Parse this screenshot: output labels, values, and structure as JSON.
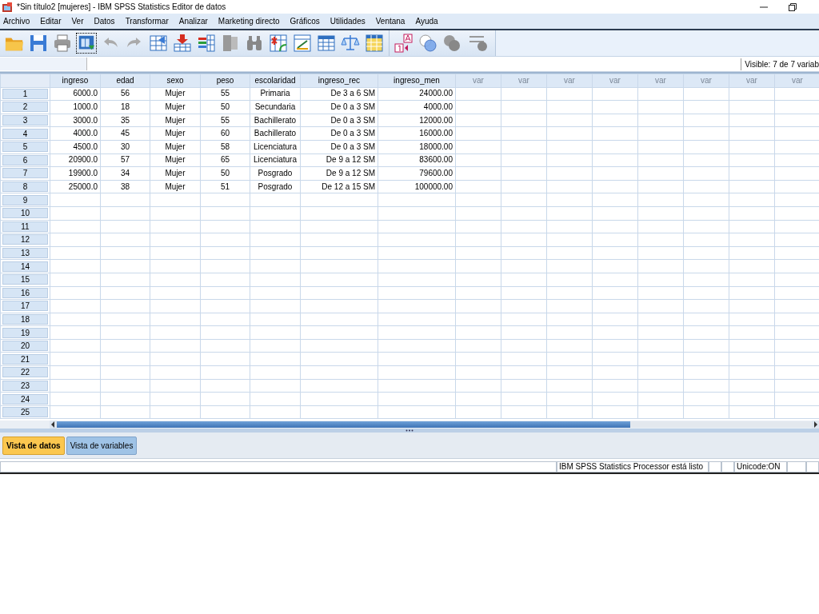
{
  "window": {
    "title": "*Sin título2 [mujeres] - IBM SPSS Statistics Editor de datos"
  },
  "menu": [
    "Archivo",
    "Editar",
    "Ver",
    "Datos",
    "Transformar",
    "Analizar",
    "Marketing directo",
    "Gráficos",
    "Utilidades",
    "Ventana",
    "Ayuda"
  ],
  "visible_info": "Visible: 7 de 7 variab",
  "table": {
    "columns": [
      {
        "label": "ingreso",
        "kind": "variable"
      },
      {
        "label": "edad",
        "kind": "variable"
      },
      {
        "label": "sexo",
        "kind": "variable"
      },
      {
        "label": "peso",
        "kind": "variable"
      },
      {
        "label": "escolaridad",
        "kind": "variable"
      },
      {
        "label": "ingreso_rec",
        "kind": "variable"
      },
      {
        "label": "ingreso_men",
        "kind": "variable"
      },
      {
        "label": "var",
        "kind": "empty"
      },
      {
        "label": "var",
        "kind": "empty"
      },
      {
        "label": "var",
        "kind": "empty"
      },
      {
        "label": "var",
        "kind": "empty"
      },
      {
        "label": "var",
        "kind": "empty"
      },
      {
        "label": "var",
        "kind": "empty"
      },
      {
        "label": "var",
        "kind": "empty"
      },
      {
        "label": "var",
        "kind": "empty"
      }
    ],
    "rows": [
      {
        "number": "1",
        "cells": [
          "6000.0",
          "56",
          "Mujer",
          "55",
          "Primaria",
          "De 3 a 6 SM",
          "24000.00"
        ]
      },
      {
        "number": "2",
        "cells": [
          "1000.0",
          "18",
          "Mujer",
          "50",
          "Secundaria",
          "De 0 a 3 SM",
          "4000.00"
        ]
      },
      {
        "number": "3",
        "cells": [
          "3000.0",
          "35",
          "Mujer",
          "55",
          "Bachillerato",
          "De 0 a 3 SM",
          "12000.00"
        ]
      },
      {
        "number": "4",
        "cells": [
          "4000.0",
          "45",
          "Mujer",
          "60",
          "Bachillerato",
          "De 0 a 3 SM",
          "16000.00"
        ]
      },
      {
        "number": "5",
        "cells": [
          "4500.0",
          "30",
          "Mujer",
          "58",
          "Licenciatura",
          "De 0 a 3 SM",
          "18000.00"
        ]
      },
      {
        "number": "6",
        "cells": [
          "20900.0",
          "57",
          "Mujer",
          "65",
          "Licenciatura",
          "De 9 a 12 SM",
          "83600.00"
        ]
      },
      {
        "number": "7",
        "cells": [
          "19900.0",
          "34",
          "Mujer",
          "50",
          "Posgrado",
          "De 9 a 12 SM",
          "79600.00"
        ]
      },
      {
        "number": "8",
        "cells": [
          "25000.0",
          "38",
          "Mujer",
          "51",
          "Posgrado",
          "De 12 a 15 SM",
          "100000.00"
        ]
      },
      {
        "number": "9"
      },
      {
        "number": "10"
      },
      {
        "number": "11"
      },
      {
        "number": "12"
      },
      {
        "number": "13"
      },
      {
        "number": "14"
      },
      {
        "number": "15"
      },
      {
        "number": "16"
      },
      {
        "number": "17"
      },
      {
        "number": "18"
      },
      {
        "number": "19"
      },
      {
        "number": "20"
      },
      {
        "number": "21"
      },
      {
        "number": "22"
      },
      {
        "number": "23"
      },
      {
        "number": "24"
      },
      {
        "number": "25"
      }
    ]
  },
  "tabs": [
    {
      "label": "Vista de datos",
      "selected": true
    },
    {
      "label": "Vista de variables",
      "selected": false
    }
  ],
  "status_bar": {
    "message": "IBM SPSS Statistics Processor está listo",
    "encoding": "Unicode:ON"
  }
}
